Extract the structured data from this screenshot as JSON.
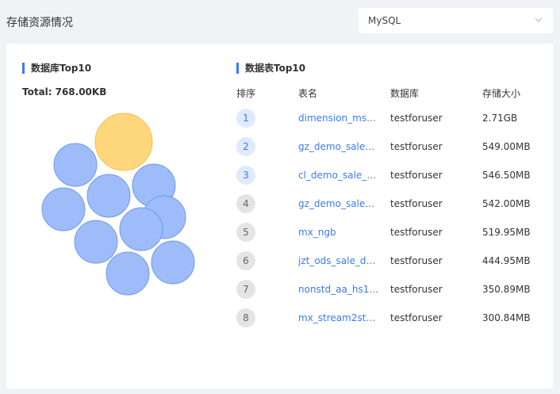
{
  "page": {
    "title": "存储资源情况"
  },
  "selector": {
    "value": "MySQL"
  },
  "db_panel": {
    "title": "数据库Top10",
    "total_label": "Total:",
    "total_value": "768.00KB",
    "bubble_colors": {
      "highlight_fill": "#fed77d",
      "highlight_stroke": "#f2c04a",
      "fill": "#9dbcf9",
      "stroke": "#6f9af0"
    }
  },
  "table_panel": {
    "title": "数据表Top10",
    "columns": {
      "rank": "排序",
      "name": "表名",
      "db": "数据库",
      "size": "存储大小"
    },
    "rows": [
      {
        "rank": "1",
        "name": "dimension_ms_h…",
        "db": "testforuser",
        "size": "2.71GB"
      },
      {
        "rank": "2",
        "name": "gz_demo_sale_c…",
        "db": "testforuser",
        "size": "549.00MB"
      },
      {
        "rank": "3",
        "name": "cl_demo_sale_c…",
        "db": "testforuser",
        "size": "546.50MB"
      },
      {
        "rank": "4",
        "name": "gz_demo_sale_c…",
        "db": "testforuser",
        "size": "542.00MB"
      },
      {
        "rank": "5",
        "name": "mx_ngb",
        "db": "testforuser",
        "size": "519.95MB"
      },
      {
        "rank": "6",
        "name": "jzt_ods_sale_det…",
        "db": "testforuser",
        "size": "444.95MB"
      },
      {
        "rank": "7",
        "name": "nonstd_aa_hs1_…",
        "db": "testforuser",
        "size": "350.89MB"
      },
      {
        "rank": "8",
        "name": "mx_stream2stre…",
        "db": "testforuser",
        "size": "300.84MB"
      }
    ]
  },
  "colors": {
    "accent": "#3a7bf2"
  }
}
